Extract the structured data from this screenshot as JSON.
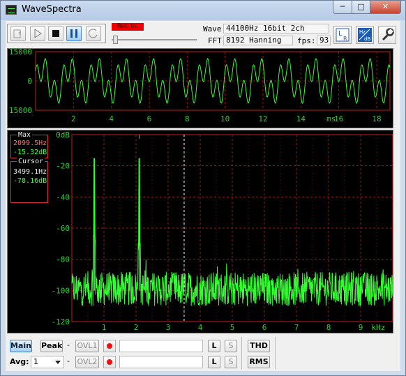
{
  "window": {
    "title": "WaveSpectra",
    "min_glyph": "─",
    "max_glyph": "□",
    "close_glyph": "✕"
  },
  "toolbar": {
    "rec_indicator": "Rec.In.",
    "wave_label": "Wave:",
    "wave_value": "44100Hz 16bit 2ch",
    "fft_label": "FFT:",
    "fft_value": "8192 Hanning",
    "fps_label": "fps:",
    "fps_value": "93",
    "pause_active": true
  },
  "wave_plot": {
    "y_ticks": [
      "15000",
      "0",
      "-15000"
    ],
    "x_ticks": [
      "2",
      "4",
      "6",
      "8",
      "10",
      "12",
      "14",
      "16",
      "18"
    ],
    "x_unit": "ms",
    "trace_color": "#33ff33"
  },
  "spectrum_plot": {
    "y_ticks": [
      "0dB",
      "-20",
      "-40",
      "-60",
      "-80",
      "-100",
      "-120"
    ],
    "x_ticks": [
      "1",
      "2",
      "3",
      "4",
      "5",
      "6",
      "7",
      "8",
      "9",
      "10"
    ],
    "x_unit": "kHz",
    "max_label": "Max",
    "max_freq": "2099.5Hz",
    "max_level": "-15.32dB",
    "cursor_label": "Cursor",
    "cursor_freq": "3499.1Hz",
    "cursor_level": "-78.16dB",
    "trace_color": "#33ff33",
    "grid_color": "#b01010"
  },
  "chart_data": [
    {
      "type": "line",
      "xlabel": "ms",
      "xlim": [
        0,
        18.7
      ],
      "ylim": [
        -15000,
        15000
      ],
      "series": [
        {
          "x": [
            0,
            2,
            4,
            6,
            8,
            10,
            12,
            14,
            16,
            18
          ],
          "values": [
            2000,
            -11000,
            9000,
            -9000,
            11000,
            -6000,
            8000,
            -12000,
            9000,
            -10000
          ]
        }
      ]
    },
    {
      "type": "line",
      "xlabel": "kHz",
      "ylabel": "dB",
      "xlim": [
        0,
        10
      ],
      "ylim": [
        -120,
        0
      ],
      "series": [
        {
          "x": [
            0.7,
            2.1
          ],
          "values": [
            -15.3,
            -15.3
          ]
        }
      ],
      "noise_floor_db": -100
    }
  ],
  "bottom": {
    "main_label": "Main",
    "peak_label": "Peak",
    "dash": "-",
    "ovl1_label": "OVL1",
    "ovl2_label": "OVL2",
    "l_label": "L",
    "s_label": "S",
    "thd_label": "THD",
    "rms_label": "RMS",
    "avg_label": "Avg:",
    "avg_value": "1"
  }
}
